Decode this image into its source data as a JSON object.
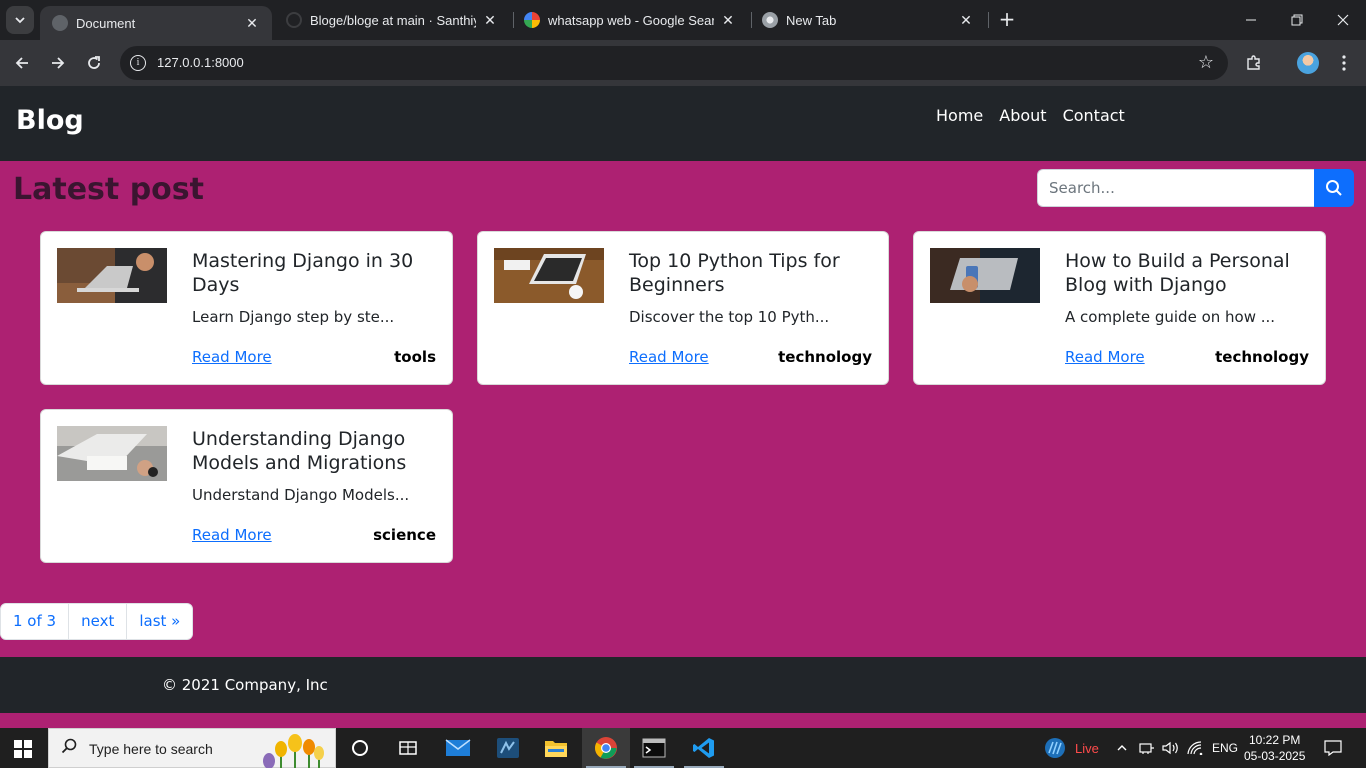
{
  "browser": {
    "tabs": [
      {
        "title": "Document",
        "active": true
      },
      {
        "title": "Bloge/bloge at main · Santhiya",
        "active": false
      },
      {
        "title": "whatsapp web - Google Search",
        "active": false
      },
      {
        "title": "New Tab",
        "active": false
      }
    ],
    "address": "127.0.0.1:8000"
  },
  "site": {
    "brand": "Blog",
    "nav": [
      "Home",
      "About",
      "Contact"
    ],
    "heading": "Latest post",
    "search_placeholder": "Search...",
    "posts": [
      {
        "title": "Mastering Django in 30 Days",
        "excerpt": "Learn Django step by ste...",
        "link": "Read More",
        "category": "tools"
      },
      {
        "title": "Top 10 Python Tips for Beginners",
        "excerpt": "Discover the top 10 Pyth...",
        "link": "Read More",
        "category": "technology"
      },
      {
        "title": "How to Build a Personal Blog with Django",
        "excerpt": "A complete guide on how ...",
        "link": "Read More",
        "category": "technology"
      },
      {
        "title": "Understanding Django Models and Migrations",
        "excerpt": "Understand Django Models...",
        "link": "Read More",
        "category": "science"
      }
    ],
    "pagination": [
      "1 of 3",
      "next",
      "last »"
    ],
    "footer": "© 2021 Company, Inc"
  },
  "taskbar": {
    "search_placeholder": "Type here to search",
    "live_label": "Live",
    "language": "ENG",
    "time": "10:22 PM",
    "date": "05-03-2025"
  },
  "colors": {
    "page_bg": "#ad2172",
    "navbar_bg": "#212529",
    "primary": "#0d6efd"
  }
}
